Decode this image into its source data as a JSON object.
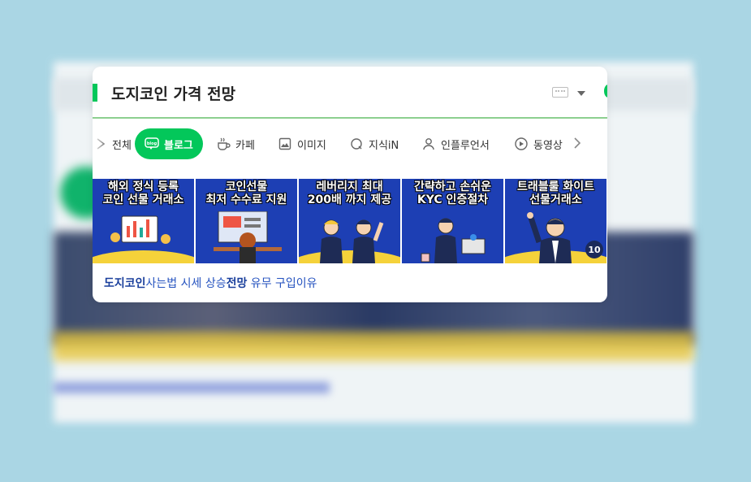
{
  "search": {
    "query": "도지코인 가격 전망"
  },
  "tabs": [
    {
      "label": "전체",
      "icon": "all-icon"
    },
    {
      "label": "블로그",
      "icon": "blog-icon",
      "active": true
    },
    {
      "label": "카페",
      "icon": "cafe-icon"
    },
    {
      "label": "이미지",
      "icon": "image-icon"
    },
    {
      "label": "지식iN",
      "icon": "knowledge-icon"
    },
    {
      "label": "인플루언서",
      "icon": "influencer-icon"
    },
    {
      "label": "동영상",
      "icon": "video-icon"
    }
  ],
  "thumbnails": [
    {
      "line1": "해외 정식 등록",
      "line2": "코인 선물 거래소"
    },
    {
      "line1": "코인선물",
      "line2": "최저 수수료 지원"
    },
    {
      "line1": "레버리지 최대",
      "line2": "200배 까지 제공"
    },
    {
      "line1": "간략하고 손쉬운",
      "line2": "KYC 인증절차"
    },
    {
      "line1": "트래블룰 화이트",
      "line2": "선물거래소"
    }
  ],
  "image_count": "10",
  "result": {
    "part1": "도지코인",
    "part2": "사는법 시세 상승",
    "part3": "전망",
    "part4": " 유무 구입이유"
  },
  "colors": {
    "accent": "#03c75a",
    "thumb_bg": "#1d3fb4",
    "link": "#2452bf"
  }
}
